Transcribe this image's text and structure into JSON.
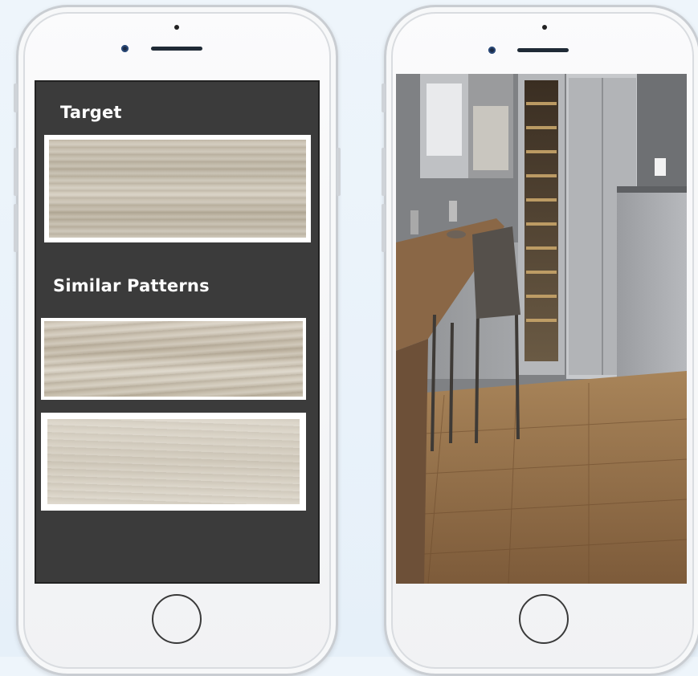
{
  "left_phone": {
    "target_label": "Target",
    "similar_label": "Similar Patterns"
  },
  "right_phone": {
    "scene": "kitchen-room-preview"
  },
  "colors": {
    "screen_bg": "#3b3b3b",
    "label_text": "#ffffff",
    "phone_body": "#f4f5f7"
  }
}
